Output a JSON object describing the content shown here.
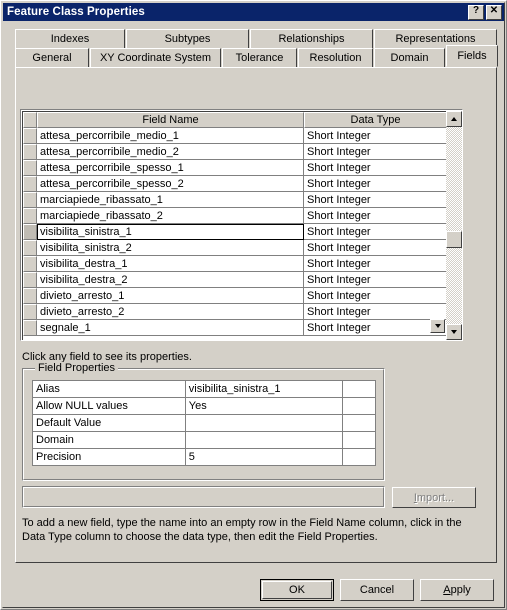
{
  "window": {
    "title": "Feature Class Properties",
    "help_button": "?",
    "close_button": "✕"
  },
  "tabs": {
    "row_top": [
      {
        "label": "Indexes",
        "width": 110,
        "active": false
      },
      {
        "label": "Subtypes",
        "width": 123,
        "active": false
      },
      {
        "label": "Relationships",
        "width": 123,
        "active": false
      },
      {
        "label": "Representations",
        "width": 123,
        "active": false
      }
    ],
    "row_bottom": [
      {
        "label": "General",
        "width": 74,
        "active": false
      },
      {
        "label": "XY Coordinate System",
        "width": 131,
        "active": false
      },
      {
        "label": "Tolerance",
        "width": 75,
        "active": false
      },
      {
        "label": "Resolution",
        "width": 75,
        "active": false
      },
      {
        "label": "Domain",
        "width": 71,
        "active": false
      },
      {
        "label": "Fields",
        "width": 52,
        "active": true
      }
    ]
  },
  "grid": {
    "columns": [
      "",
      "Field Name",
      "Data Type"
    ],
    "rows": [
      {
        "name": "attesa_percorribile_medio_1",
        "type": "Short Integer",
        "selected": false
      },
      {
        "name": "attesa_percorribile_medio_2",
        "type": "Short Integer",
        "selected": false
      },
      {
        "name": "attesa_percorribile_spesso_1",
        "type": "Short Integer",
        "selected": false
      },
      {
        "name": "attesa_percorribile_spesso_2",
        "type": "Short Integer",
        "selected": false
      },
      {
        "name": "marciapiede_ribassato_1",
        "type": "Short Integer",
        "selected": false
      },
      {
        "name": "marciapiede_ribassato_2",
        "type": "Short Integer",
        "selected": false
      },
      {
        "name": "visibilita_sinistra_1",
        "type": "Short Integer",
        "selected": true
      },
      {
        "name": "visibilita_sinistra_2",
        "type": "Short Integer",
        "selected": false
      },
      {
        "name": "visibilita_destra_1",
        "type": "Short Integer",
        "selected": false
      },
      {
        "name": "visibilita_destra_2",
        "type": "Short Integer",
        "selected": false
      },
      {
        "name": "divieto_arresto_1",
        "type": "Short Integer",
        "selected": false
      },
      {
        "name": "divieto_arresto_2",
        "type": "Short Integer",
        "selected": false
      },
      {
        "name": "segnale_1",
        "type": "Short Integer",
        "selected": false
      }
    ],
    "scroll_up_icon": "arrow-up-icon",
    "scroll_down_icon": "arrow-down-icon"
  },
  "hint": "Click any field to see its properties.",
  "field_properties": {
    "legend": "Field Properties",
    "rows": [
      {
        "label": "Alias",
        "value": "visibilita_sinistra_1"
      },
      {
        "label": "Allow NULL values",
        "value": "Yes"
      },
      {
        "label": "Default Value",
        "value": ""
      },
      {
        "label": "Domain",
        "value": ""
      },
      {
        "label": "Precision",
        "value": "5"
      }
    ]
  },
  "import_button": {
    "label": "Import...",
    "accel": "I",
    "enabled": false
  },
  "instructions": "To add a new field, type the name into an empty row in the Field Name column, click in the Data Type column to choose the data type, then edit the Field Properties.",
  "dialog_buttons": {
    "ok": "OK",
    "cancel": "Cancel",
    "apply": "Apply",
    "apply_accel": "A"
  },
  "colors": {
    "titlebar": "#0a246a",
    "face": "#d4d0c8",
    "field": "#ffffff",
    "disabled_text": "#808080"
  }
}
